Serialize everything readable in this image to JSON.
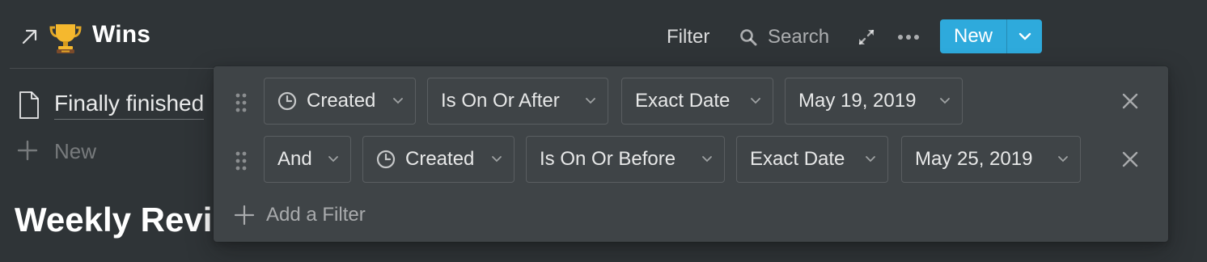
{
  "header": {
    "title": "Wins",
    "filter_label": "Filter",
    "search_label": "Search",
    "new_label": "New"
  },
  "content": {
    "row_title": "Finally finished",
    "add_row_label": "New",
    "section_heading": "Weekly Review"
  },
  "filter_popover": {
    "rules": [
      {
        "property": "Created",
        "condition": "Is On Or After",
        "date_type": "Exact Date",
        "value": "May 19, 2019"
      },
      {
        "conjunction": "And",
        "property": "Created",
        "condition": "Is On Or Before",
        "date_type": "Exact Date",
        "value": "May 25, 2019"
      }
    ],
    "add_filter_label": "Add a Filter"
  },
  "colors": {
    "background": "#2f3437",
    "popover": "#3f4447",
    "accent": "#2eaadc"
  },
  "icons": [
    "open-as-page-icon",
    "trophy-icon",
    "search-icon",
    "expand-icon",
    "more-icon",
    "chevron-down-icon",
    "page-icon",
    "plus-icon",
    "drag-handle-icon",
    "clock-icon",
    "close-icon"
  ]
}
